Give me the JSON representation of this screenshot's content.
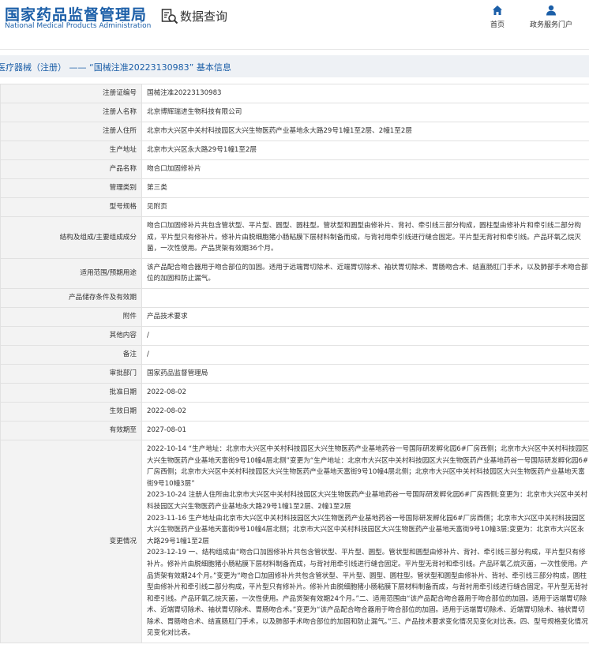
{
  "header": {
    "logo_cn": "国家药品监督管理局",
    "logo_en": "National Medical Products Administration",
    "section_title": "数据查询",
    "section_icon": "search-document-icon",
    "nav": [
      {
        "label": "首页",
        "icon": "home-icon"
      },
      {
        "label": "政务服务门户",
        "icon": "user-icon"
      }
    ]
  },
  "breadcrumb": "医疗器械（注册） —— “国械注准20223130983” 基本信息",
  "rows": [
    {
      "label": "注册证编号",
      "value": "国械注准20223130983"
    },
    {
      "label": "注册人名称",
      "value": "北京博辉瑞进生物科技有限公司"
    },
    {
      "label": "注册人住所",
      "value": "北京市大兴区中关村科技园区大兴生物医药产业基地永大路29号1幢1至2层、2幢1至2层"
    },
    {
      "label": "生产地址",
      "value": "北京市大兴区永大路29号1幢1至2层"
    },
    {
      "label": "产品名称",
      "value": "吻合口加固修补片"
    },
    {
      "label": "管理类别",
      "value": "第三类"
    },
    {
      "label": "型号规格",
      "value": "见附页"
    },
    {
      "label": "结构及组成/主要组成成分",
      "value": "吻合口加固修补片共包含管状型、平片型、圆型、圆柱型。管状型和圆型由修补片、背衬、牵引线三部分构成，圆柱型由修补片和牵引线二部分构成，平片型只有修补片。修补片由脱细胞猪小肠粘膜下层材料制备而成，与背衬用牵引线进行缝合固定。平片型无背衬和牵引线。产品环氧乙烷灭菌，一次性使用。产品货架有效期36个月。"
    },
    {
      "label": "适用范围/预期用途",
      "value": "该产品配合吻合器用于吻合部位的加固。适用于远端胃切除术、近端胃切除术、袖状胃切除术、胃肠吻合术、结直肠肛门手术，以及肺部手术吻合部位的加固和防止漏气。"
    },
    {
      "label": "产品储存条件及有效期",
      "value": ""
    },
    {
      "label": "附件",
      "value": "产品技术要求"
    },
    {
      "label": "其他内容",
      "value": "/"
    },
    {
      "label": "备注",
      "value": "/"
    },
    {
      "label": "审批部门",
      "value": "国家药品监督管理局"
    },
    {
      "label": "批准日期",
      "value": "2022-08-02"
    },
    {
      "label": "生效日期",
      "value": "2022-08-02"
    },
    {
      "label": "有效期至",
      "value": "2027-08-01"
    }
  ],
  "changes": {
    "label": "变更情况",
    "entries": [
      "2022-10-14 “生产地址：北京市大兴区中关村科技园区大兴生物医药产业基地药谷一号国际研发孵化园6#厂房西侧；北京市大兴区中关村科技园区大兴生物医药产业基地天富街9号10幢4层北侧”变更为“生产地址：北京市大兴区中关村科技园区大兴生物医药产业基地药谷一号国际研发孵化园6#厂房西侧；北京市大兴区中关村科技园区大兴生物医药产业基地天富街9号10幢4层北侧；北京市大兴区中关村科技园区大兴生物医药产业基地天富街9号10幢3层”",
      "2023-10-24 注册人住所由北京市大兴区中关村科技园区大兴生物医药产业基地药谷一号国际研发孵化园6#厂房西侧;变更为：北京市大兴区中关村科技园区大兴生物医药产业基地永大路29号1幢1至2层、2幢1至2层",
      "2023-11-16 生产地址由北京市大兴区中关村科技园区大兴生物医药产业基地药谷一号国际研发孵化园6#厂房西侧；北京市大兴区中关村科技园区大兴生物医药产业基地天富街9号10幢4层北侧；北京市大兴区中关村科技园区大兴生物医药产业基地天富街9号10幢3层;变更为：北京市大兴区永大路29号1幢1至2层",
      "2023-12-19 一、结构组成由“吻合口加固修补片共包含管状型、平片型、圆型。管状型和圆型由修补片、背衬、牵引线三部分构成，平片型只有修补片。修补片由脱细胞猪小肠粘膜下层材料制备而成，与背衬用牵引线进行缝合固定。平片型无背衬和牵引线。产品环氧乙烷灭菌，一次性使用。产品货架有效期24个月。”变更为“吻合口加固修补片共包含管状型、平片型、圆型、圆柱型。管状型和圆型由修补片、背衬、牵引线三部分构成，圆柱型由修补片和牵引线二部分构成，平片型只有修补片。修补片由脱细胞猪小肠粘膜下层材料制备而成，与背衬用牵引线进行缝合固定。平片型无背衬和牵引线。产品环氧乙烷灭菌，一次性使用。产品货架有效期24个月。”二、适用范围由“该产品配合吻合器用于吻合部位的加固。适用于远端胃切除术、近端胃切除术、袖状胃切除术、胃肠吻合术。”变更为“该产品配合吻合器用于吻合部位的加固。适用于远端胃切除术、近端胃切除术、袖状胃切除术、胃肠吻合术、结直肠肛门手术，以及肺部手术吻合部位的加固和防止漏气。”三、产品技术要求变化情况见变化对比表。四、型号规格变化情况见变化对比表。"
    ]
  }
}
